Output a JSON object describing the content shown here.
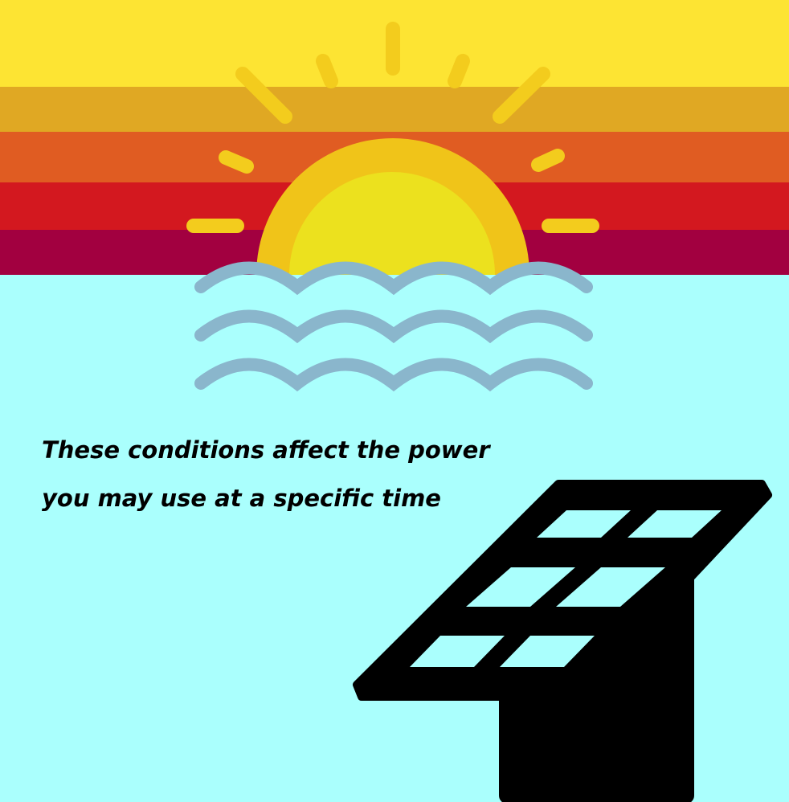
{
  "scene": {
    "caption_lines": [
      "These conditions affect the power",
      "you may use at a specific time"
    ],
    "icons": [
      "sunset-icon",
      "waves-icon",
      "solar-panel-icon"
    ]
  },
  "colors": {
    "sky_stripes": [
      "#fde433",
      "#e0a823",
      "#e05c22",
      "#d3181f",
      "#a20040"
    ],
    "sea": "#aafffd",
    "sun_outer": "#f0c419",
    "sun_inner": "#ece11e",
    "sun_rays": "#f3cc1d",
    "waves": "#8ab6cc",
    "solar_panel": "#000000",
    "panel_cells": "#aafffd",
    "caption": "#000000"
  }
}
